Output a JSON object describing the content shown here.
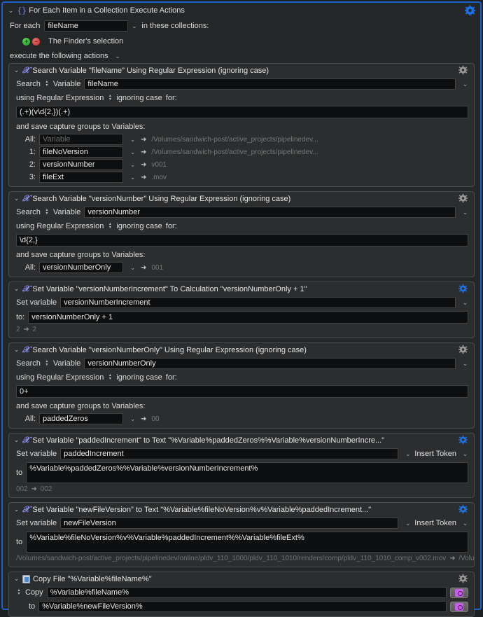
{
  "colors": {
    "selection_border": "#1a62c9",
    "gear_active": "#1a73e8",
    "gear_inactive": "#9a9a9a",
    "action_icon_purple": "#8f93ee",
    "file_button_purple": "#c660e8"
  },
  "foreach": {
    "title": "For Each Item in a Collection Execute Actions",
    "icon": "braces-icon",
    "for_each_label": "For each",
    "variable_value": "fileName",
    "in_collections_label": "in these collections:",
    "collection_item": "The Finder's selection",
    "add_icon": "plus-circle-icon",
    "remove_icon": "minus-circle-icon",
    "execute_label": "execute the following actions",
    "gear": "gear-icon-active"
  },
  "actions": [
    {
      "icon": "script-x-icon",
      "title": "Search Variable \"fileName\" Using Regular Expression (ignoring case)",
      "gear_active": false,
      "search_label": "Search",
      "search_target": "Variable",
      "search_variable": "fileName",
      "regex_label": "using Regular Expression",
      "case_label": "ignoring case",
      "for_label": "for:",
      "regex": "(.+)(v\\d{2,})(.+)",
      "capture_label": "and save capture groups to Variables:",
      "captures": [
        {
          "index": "All:",
          "value": "Variable",
          "placeholder": true,
          "result": "/Volumes/sandwich-post/active_projects/pipelinedev..."
        },
        {
          "index": "1:",
          "value": "fileNoVersion",
          "placeholder": false,
          "result": "/Volumes/sandwich-post/active_projects/pipelinedev..."
        },
        {
          "index": "2:",
          "value": "versionNumber",
          "placeholder": false,
          "result": "v001"
        },
        {
          "index": "3:",
          "value": "fileExt",
          "placeholder": false,
          "result": ".mov"
        }
      ]
    },
    {
      "icon": "script-x-icon",
      "title": "Search Variable \"versionNumber\" Using Regular Expression (ignoring case)",
      "gear_active": false,
      "search_label": "Search",
      "search_target": "Variable",
      "search_variable": "versionNumber",
      "regex_label": "using Regular Expression",
      "case_label": "ignoring case",
      "for_label": "for:",
      "regex": "\\d{2,}",
      "capture_label": "and save capture groups to Variables:",
      "captures": [
        {
          "index": "All:",
          "value": "versionNumberOnly",
          "placeholder": false,
          "result": "001"
        }
      ]
    },
    {
      "icon": "script-x-icon",
      "title": "Set Variable \"versionNumberIncrement\" To Calculation \"versionNumberOnly + 1\"",
      "gear_active": true,
      "set_variable_label": "Set variable",
      "set_variable_value": "versionNumberIncrement",
      "to_label": "to:",
      "to_value": "versionNumberOnly + 1",
      "result_before": "2",
      "result_after": "2"
    },
    {
      "icon": "script-x-icon",
      "title": "Search Variable \"versionNumberOnly\" Using Regular Expression (ignoring case)",
      "gear_active": false,
      "search_label": "Search",
      "search_target": "Variable",
      "search_variable": "versionNumberOnly",
      "regex_label": "using Regular Expression",
      "case_label": "ignoring case",
      "for_label": "for:",
      "regex": "0+",
      "capture_label": "and save capture groups to Variables:",
      "captures": [
        {
          "index": "All:",
          "value": "paddedZeros",
          "placeholder": false,
          "result": "00"
        }
      ]
    },
    {
      "icon": "script-x-icon",
      "title": "Set Variable \"paddedIncrement\" to Text \"%Variable%paddedZeros%%Variable%versionNumberIncre...\"",
      "gear_active": true,
      "set_variable_label": "Set variable",
      "set_variable_value": "paddedIncrement",
      "insert_token_label": "Insert Token",
      "to_label": "to",
      "to_value": "%Variable%paddedZeros%%Variable%versionNumberIncrement%",
      "result_before": "002",
      "result_after": "002"
    },
    {
      "icon": "script-x-icon",
      "title": "Set Variable \"newFileVersion\" to Text \"%Variable%fileNoVersion%v%Variable%paddedIncrement...\"",
      "gear_active": true,
      "set_variable_label": "Set variable",
      "set_variable_value": "newFileVersion",
      "insert_token_label": "Insert Token",
      "to_label": "to",
      "to_value": "%Variable%fileNoVersion%v%Variable%paddedIncrement%%Variable%fileExt%",
      "result_before": "/Volumes/sandwich-post/active_projects/pipelinedev/online/pldv_110_1000/pldv_110_1010/renders/comp/pldv_110_1010_comp_v002.mov",
      "result_after": "/Volume..."
    },
    {
      "icon": "document-icon",
      "title": "Copy File \"%Variable%fileName%\"",
      "gear_active": false,
      "copy_label": "Copy",
      "copy_value": "%Variable%fileName%",
      "to_label": "to",
      "to_value": "%Variable%newFileVersion%",
      "file_button_icon": "file-chooser-icon"
    }
  ]
}
